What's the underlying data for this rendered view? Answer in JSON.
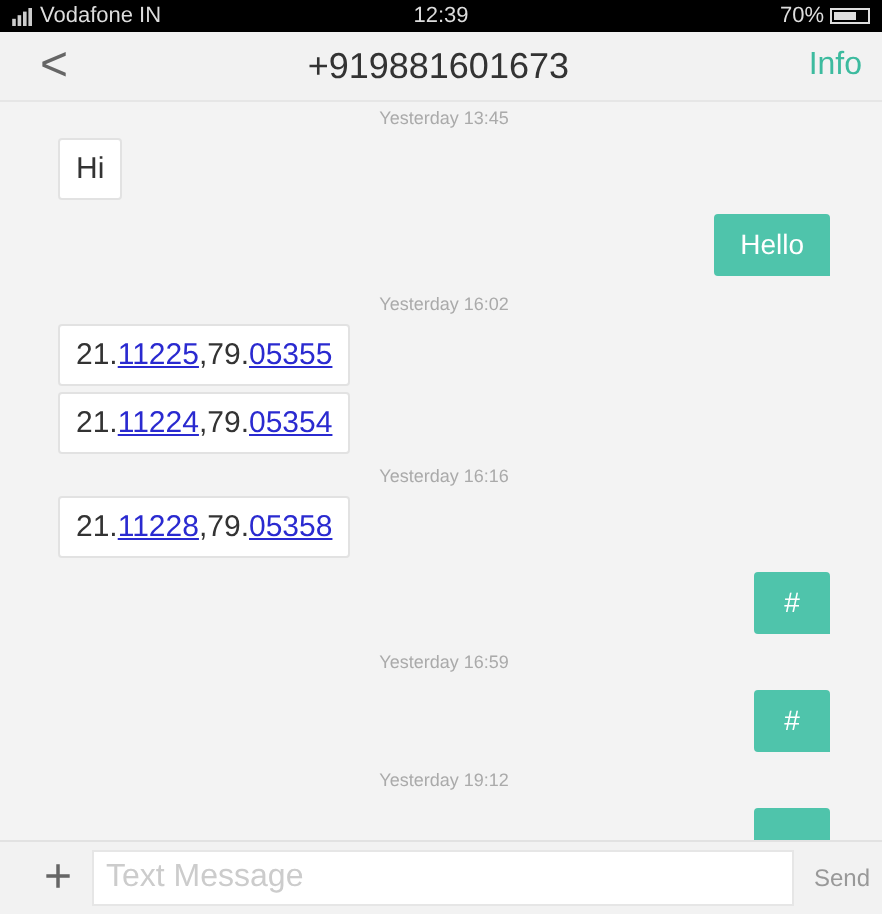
{
  "status_bar": {
    "carrier": "Vodafone IN",
    "time": "12:39",
    "battery": "70%"
  },
  "header": {
    "back": "<",
    "title": "+919881601673",
    "action": "Info"
  },
  "messages": [
    {
      "kind": "time",
      "text": "Yesterday 13:45"
    },
    {
      "kind": "incoming",
      "parts": [
        {
          "text": "Hi",
          "link": false
        }
      ]
    },
    {
      "kind": "outgoing",
      "parts": [
        {
          "text": "Hello",
          "link": false
        }
      ]
    },
    {
      "kind": "time",
      "text": "Yesterday 16:02"
    },
    {
      "kind": "incoming",
      "parts": [
        {
          "text": "21.",
          "link": false
        },
        {
          "text": "11225",
          "link": true
        },
        {
          "text": ",79.",
          "link": false
        },
        {
          "text": "05355",
          "link": true
        }
      ]
    },
    {
      "kind": "incoming",
      "parts": [
        {
          "text": "21.",
          "link": false
        },
        {
          "text": "11224",
          "link": true
        },
        {
          "text": ",79.",
          "link": false
        },
        {
          "text": "05354",
          "link": true
        }
      ]
    },
    {
      "kind": "time",
      "text": "Yesterday 16:16"
    },
    {
      "kind": "incoming",
      "parts": [
        {
          "text": "21.",
          "link": false
        },
        {
          "text": "11228",
          "link": true
        },
        {
          "text": ",79.",
          "link": false
        },
        {
          "text": "05358",
          "link": true
        }
      ]
    },
    {
      "kind": "outgoing",
      "parts": [
        {
          "text": "#",
          "link": false
        }
      ]
    },
    {
      "kind": "time",
      "text": "Yesterday 16:59"
    },
    {
      "kind": "outgoing",
      "parts": [
        {
          "text": "#",
          "link": false
        }
      ]
    },
    {
      "kind": "time",
      "text": "Yesterday 19:12"
    },
    {
      "kind": "outgoing"
    }
  ],
  "composer": {
    "add": "+",
    "placeholder": "Text Message",
    "send": "Send"
  }
}
